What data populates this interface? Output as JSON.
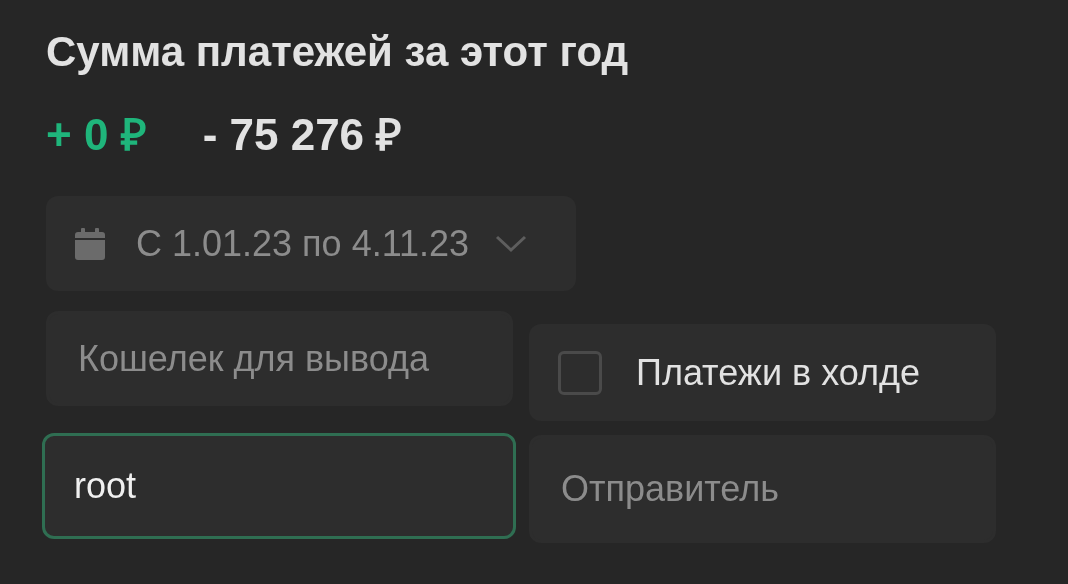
{
  "title": "Сумма платежей за этот год",
  "totals": {
    "income": "+ 0 ₽",
    "expense": "- 75 276 ₽"
  },
  "date_range": {
    "label": "С 1.01.23 по 4.11.23",
    "expanded": false
  },
  "wallet_field": {
    "placeholder": "Кошелек для вывода",
    "focused": false
  },
  "hold_checkbox": {
    "label": "Платежи в холде",
    "checked": false
  },
  "user_field": {
    "value": "root",
    "focused": true
  },
  "sender_field": {
    "placeholder": "Отправитель",
    "focused": false
  }
}
